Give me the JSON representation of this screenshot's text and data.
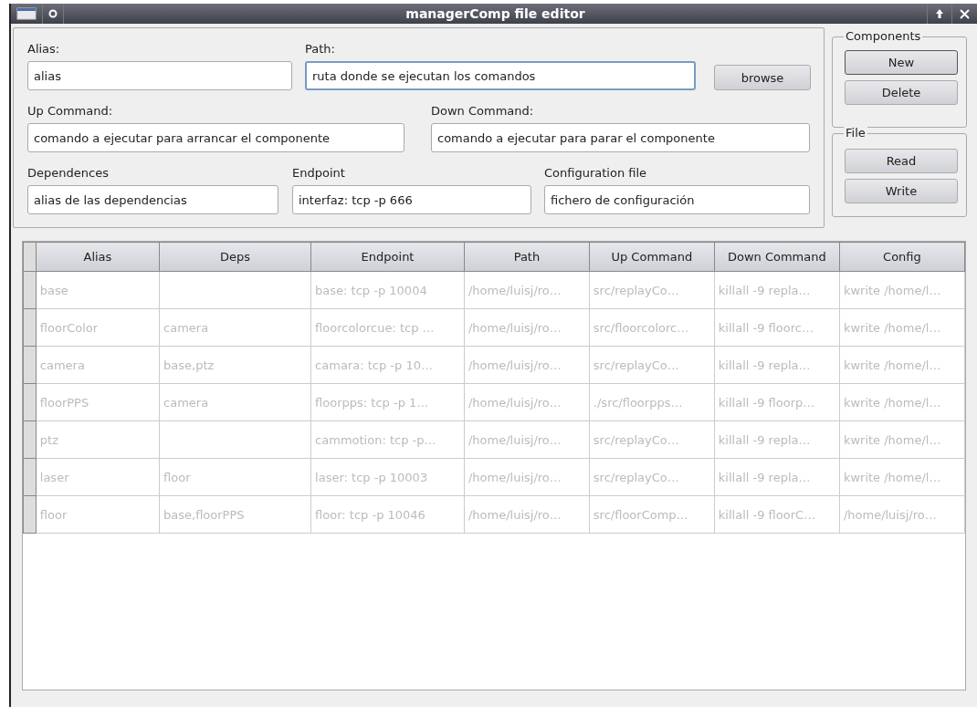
{
  "window": {
    "title": "managerComp file editor"
  },
  "form": {
    "fields": [
      {
        "label": "Alias:",
        "value": "alias",
        "focused": false
      },
      {
        "label": "Path:",
        "value": "ruta donde se ejecutan los comandos",
        "focused": true
      },
      {
        "label": "Up Command:",
        "value": "comando a ejecutar para arrancar el componente",
        "focused": false
      },
      {
        "label": "Down Command:",
        "value": "comando a ejecutar para parar el componente",
        "focused": false
      },
      {
        "label": "Dependences",
        "value": "alias de las dependencias",
        "focused": false
      },
      {
        "label": "Endpoint",
        "value": "interfaz: tcp -p 666",
        "focused": false
      },
      {
        "label": "Configuration file",
        "value": "fichero de configuración",
        "focused": false
      }
    ],
    "browse": "browse"
  },
  "groups": [
    {
      "title": "Components",
      "buttons": [
        {
          "label": "New",
          "focused": true
        },
        {
          "label": "Delete",
          "focused": false
        }
      ]
    },
    {
      "title": "File",
      "buttons": [
        {
          "label": "Read",
          "focused": false
        },
        {
          "label": "Write",
          "focused": false
        }
      ]
    }
  ],
  "table": {
    "columns": [
      "Alias",
      "Deps",
      "Endpoint",
      "Path",
      "Up Command",
      "Down Command",
      "Config"
    ],
    "rows": [
      [
        "base",
        "",
        "base: tcp -p 10004",
        "/home/luisj/ro…",
        "src/replayCo…",
        "killall -9 repla…",
        "kwrite /home/l…"
      ],
      [
        "floorColor",
        "camera",
        "floorcolorcue: tcp …",
        "/home/luisj/ro…",
        "src/floorcolorc…",
        "killall -9 floorc…",
        "kwrite /home/l…"
      ],
      [
        "camera",
        "base,ptz",
        "camara: tcp -p 10…",
        "/home/luisj/ro…",
        "src/replayCo…",
        "killall -9 repla…",
        "kwrite /home/l…"
      ],
      [
        "floorPPS",
        "camera",
        "floorpps: tcp -p 1…",
        "/home/luisj/ro…",
        "./src/floorpps…",
        "killall -9 floorp…",
        "kwrite /home/l…"
      ],
      [
        "ptz",
        "",
        "cammotion: tcp -p…",
        "/home/luisj/ro…",
        "src/replayCo…",
        "killall -9 repla…",
        "kwrite /home/l…"
      ],
      [
        "laser",
        "floor",
        "laser: tcp -p 10003",
        "/home/luisj/ro…",
        "src/replayCo…",
        "killall -9 repla…",
        "kwrite /home/l…"
      ],
      [
        "floor",
        "base,floorPPS",
        "floor: tcp -p 10046",
        "/home/luisj/ro…",
        "src/floorComp…",
        "killall -9 floorC…",
        "/home/luisj/ro…"
      ]
    ]
  }
}
